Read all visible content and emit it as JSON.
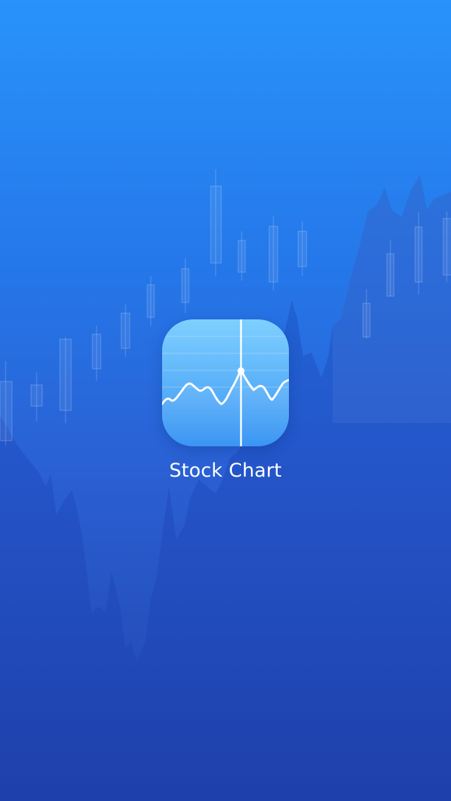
{
  "splash": {
    "app_name": "Stock Chart",
    "icon_name": "stock-chart-app-icon"
  },
  "colors": {
    "background_top": "#2893fb",
    "background_bottom": "#2141a8",
    "icon_top": "#7fd0ff",
    "icon_bottom": "#3a95f3",
    "chart_line": "#ffffff"
  }
}
